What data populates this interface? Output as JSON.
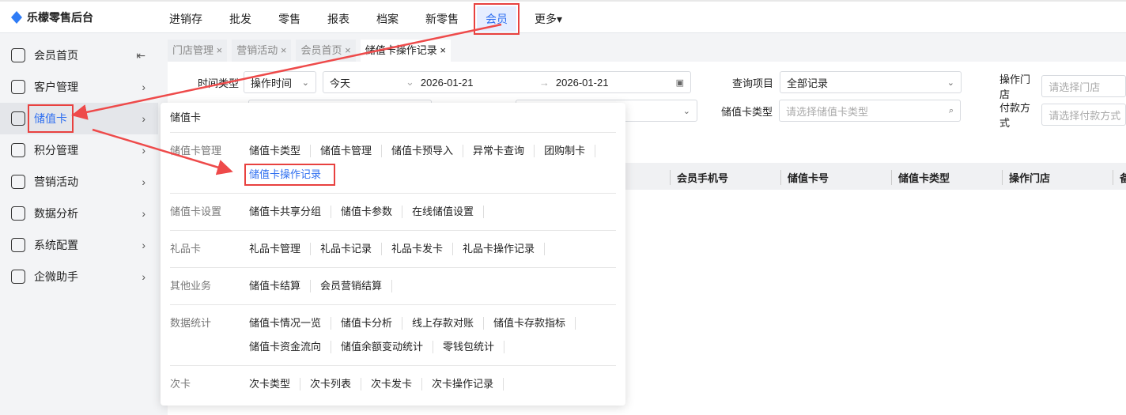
{
  "app": {
    "title": "乐檬零售后台"
  },
  "nav": [
    "进销存",
    "批发",
    "零售",
    "报表",
    "档案",
    "新零售",
    "会员",
    "更多▾"
  ],
  "sidebar": [
    {
      "label": "会员首页",
      "icon": "home-icon"
    },
    {
      "label": "客户管理",
      "icon": "user-icon"
    },
    {
      "label": "储值卡",
      "icon": "card-icon"
    },
    {
      "label": "积分管理",
      "icon": "database-icon"
    },
    {
      "label": "营销活动",
      "icon": "chart-icon"
    },
    {
      "label": "数据分析",
      "icon": "analytics-icon"
    },
    {
      "label": "系统配置",
      "icon": "settings-icon"
    },
    {
      "label": "企微助手",
      "icon": "chat-icon"
    }
  ],
  "tabs": [
    "门店管理",
    "营销活动",
    "会员首页",
    "储值卡操作记录"
  ],
  "filters": {
    "time_type_label": "时间类型",
    "time_type": "操作时间",
    "range": "今天",
    "start": "2026-01-21",
    "end": "2026-01-21",
    "query_label": "查询项目",
    "query": "全部记录",
    "store_label": "操作门店",
    "store_ph": "请选择门店",
    "cardtype_label": "储值卡类型",
    "cardtype_ph": "请选择储值卡类型",
    "pay_label": "付款方式",
    "pay_ph": "请选择付款方式"
  },
  "columns": [
    "会员手机号",
    "储值卡号",
    "储值卡类型",
    "操作门店",
    "备"
  ],
  "menu": {
    "title": "储值卡",
    "groups": [
      {
        "label": "储值卡管理",
        "items": [
          "储值卡类型",
          "储值卡管理",
          "储值卡预导入",
          "异常卡查询",
          "团购制卡",
          "储值卡操作记录"
        ]
      },
      {
        "label": "储值卡设置",
        "items": [
          "储值卡共享分组",
          "储值卡参数",
          "在线储值设置"
        ]
      },
      {
        "label": "礼品卡",
        "items": [
          "礼品卡管理",
          "礼品卡记录",
          "礼品卡发卡",
          "礼品卡操作记录"
        ]
      },
      {
        "label": "其他业务",
        "items": [
          "储值卡结算",
          "会员营销结算"
        ]
      },
      {
        "label": "数据统计",
        "items": [
          "储值卡情况一览",
          "储值卡分析",
          "线上存款对账",
          "储值卡存款指标",
          "储值卡资金流向",
          "储值余额变动统计",
          "零钱包统计"
        ]
      },
      {
        "label": "次卡",
        "items": [
          "次卡类型",
          "次卡列表",
          "次卡发卡",
          "次卡操作记录"
        ]
      }
    ]
  }
}
